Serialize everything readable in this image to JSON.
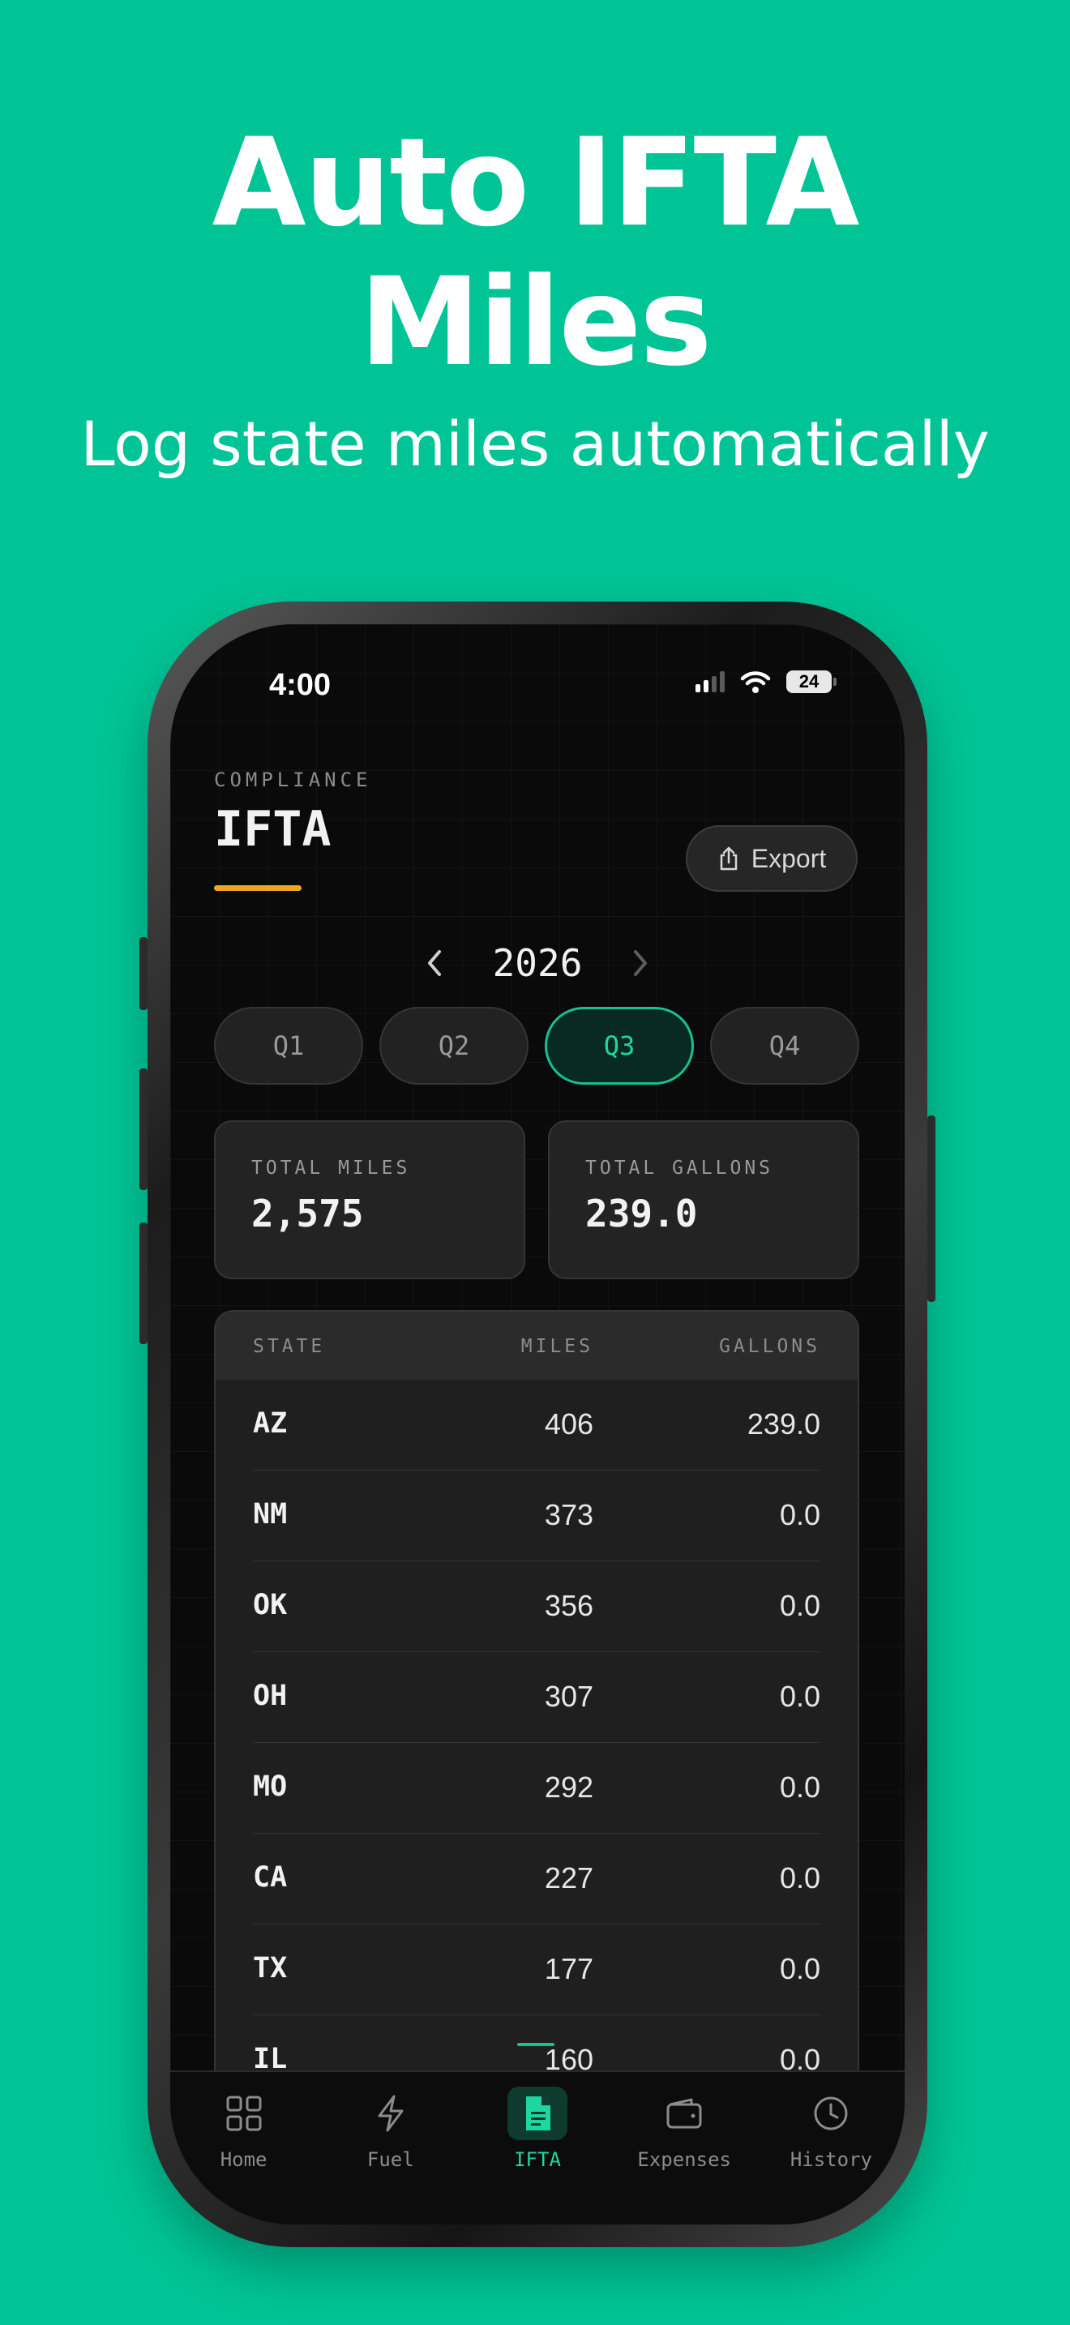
{
  "banner": {
    "headline_line1": "Auto IFTA",
    "headline_line2": "Miles",
    "subheadline": "Log state miles automatically"
  },
  "status_bar": {
    "time": "4:00",
    "battery": "24"
  },
  "header": {
    "eyebrow": "COMPLIANCE",
    "title": "IFTA",
    "export_label": "Export"
  },
  "year_selector": {
    "year": "2026"
  },
  "quarters": [
    {
      "label": "Q1",
      "active": false
    },
    {
      "label": "Q2",
      "active": false
    },
    {
      "label": "Q3",
      "active": true
    },
    {
      "label": "Q4",
      "active": false
    }
  ],
  "totals": {
    "miles_label": "TOTAL MILES",
    "miles_value": "2,575",
    "gallons_label": "TOTAL GALLONS",
    "gallons_value": "239.0"
  },
  "table": {
    "headers": {
      "state": "STATE",
      "miles": "MILES",
      "gallons": "GALLONS"
    },
    "rows": [
      {
        "state": "AZ",
        "miles": "406",
        "gallons": "239.0"
      },
      {
        "state": "NM",
        "miles": "373",
        "gallons": "0.0"
      },
      {
        "state": "OK",
        "miles": "356",
        "gallons": "0.0"
      },
      {
        "state": "OH",
        "miles": "307",
        "gallons": "0.0"
      },
      {
        "state": "MO",
        "miles": "292",
        "gallons": "0.0"
      },
      {
        "state": "CA",
        "miles": "227",
        "gallons": "0.0"
      },
      {
        "state": "TX",
        "miles": "177",
        "gallons": "0.0"
      },
      {
        "state": "IL",
        "miles": "160",
        "gallons": "0.0"
      }
    ]
  },
  "nav": [
    {
      "label": "Home",
      "icon": "grid-icon",
      "active": false
    },
    {
      "label": "Fuel",
      "icon": "lightning-icon",
      "active": false
    },
    {
      "label": "IFTA",
      "icon": "document-icon",
      "active": true
    },
    {
      "label": "Expenses",
      "icon": "wallet-icon",
      "active": false
    },
    {
      "label": "History",
      "icon": "clock-icon",
      "active": false
    }
  ],
  "colors": {
    "background": "#00c495",
    "accent_green": "#1ed7a0",
    "accent_orange": "#f0a51c",
    "screen_bg": "#0a0a0a"
  }
}
